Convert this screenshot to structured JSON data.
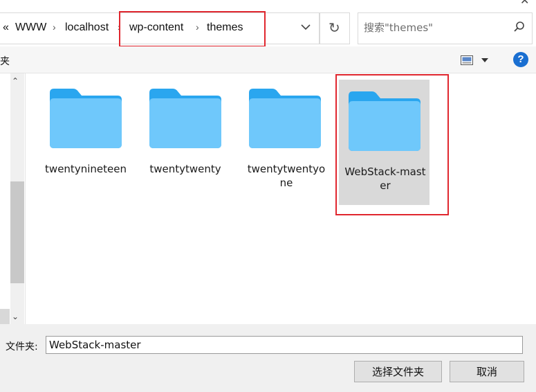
{
  "breadcrumb": {
    "overflow": "«",
    "items": [
      "WWW",
      "localhost",
      "wp-content",
      "themes"
    ],
    "separator": "›"
  },
  "refresh_icon": "refresh-icon",
  "search": {
    "placeholder": "搜索\"themes\""
  },
  "toolbar": {
    "partial_label": "夹"
  },
  "folders": [
    {
      "name": "twentynineteen",
      "selected": false
    },
    {
      "name": "twentytwenty",
      "selected": false
    },
    {
      "name": "twentytwentyone",
      "selected": false
    },
    {
      "name": "WebStack-master",
      "selected": true
    }
  ],
  "footer": {
    "filename_label": "文件夹:",
    "filename_value": "WebStack-master",
    "select_button": "选择文件夹",
    "cancel_button": "取消"
  },
  "colors": {
    "highlight": "#e0262e",
    "folder_top": "#3ab0f3",
    "folder_body": "#6cc7fb",
    "help": "#1a6fd1"
  }
}
